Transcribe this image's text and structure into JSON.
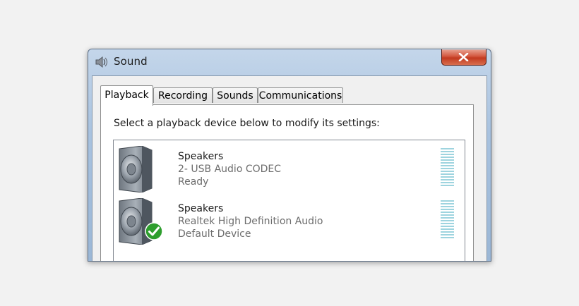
{
  "window": {
    "title": "Sound"
  },
  "tabs": [
    {
      "label": "Playback",
      "active": true
    },
    {
      "label": "Recording",
      "active": false
    },
    {
      "label": "Sounds",
      "active": false
    },
    {
      "label": "Communications",
      "active": false
    }
  ],
  "playback": {
    "instruction": "Select a playback device below to modify its settings:",
    "devices": [
      {
        "name": "Speakers",
        "description": "2- USB Audio CODEC",
        "status": "Ready",
        "icon": "speaker-icon",
        "is_default": false,
        "level": 0
      },
      {
        "name": "Speakers",
        "description": "Realtek High Definition Audio",
        "status": "Default Device",
        "icon": "speaker-icon",
        "is_default": true,
        "level": 0
      }
    ]
  },
  "colors": {
    "close_button": "#c9452b",
    "meter_bar": "#9ed4df",
    "default_check": "#2e9e2e"
  }
}
